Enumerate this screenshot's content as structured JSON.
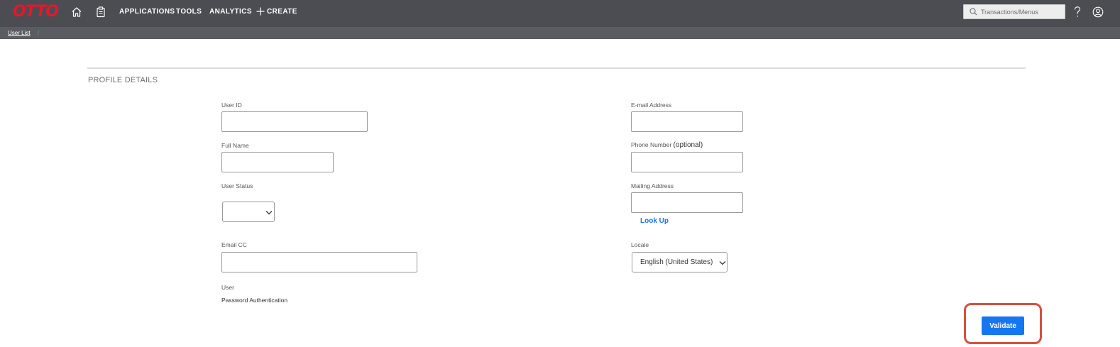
{
  "header": {
    "logo_text": "OTTO",
    "nav": {
      "applications": "APPLICATIONS",
      "tools": "TOOLS",
      "analytics": "ANALYTICS",
      "create": "CREATE"
    },
    "search": {
      "placeholder": "Transactions/Menus"
    },
    "icons": [
      "home-icon",
      "clipboard-icon",
      "plus-icon",
      "search-icon",
      "help-icon",
      "account-icon"
    ]
  },
  "breadcrumb": {
    "user_list": "User List",
    "separator": "/"
  },
  "section": {
    "title": "PROFILE DETAILS"
  },
  "form": {
    "user_id": {
      "label": "User ID",
      "value": ""
    },
    "full_name": {
      "label": "Full Name",
      "value": ""
    },
    "user_status": {
      "label": "User Status",
      "value": ""
    },
    "email_cc": {
      "label": "Email CC",
      "value": ""
    },
    "user_auth": {
      "label": "User",
      "value": "Password Authentication"
    },
    "email": {
      "label": "E-mail Address",
      "value": ""
    },
    "phone": {
      "label": "Phone Number",
      "optional": "(optional)",
      "value": ""
    },
    "mailing_address": {
      "label": "Mailing Address",
      "value": "",
      "lookup": "Look Up"
    },
    "locale": {
      "label": "Locale",
      "value": "English (United States)"
    }
  },
  "actions": {
    "validate": "Validate"
  },
  "colors": {
    "topbar": "#4b4d52",
    "subbar": "#5a5c61",
    "logo": "#e3182d",
    "primary_button": "#1576f2",
    "link": "#1a73e8",
    "highlight_ring": "#d6503f"
  }
}
